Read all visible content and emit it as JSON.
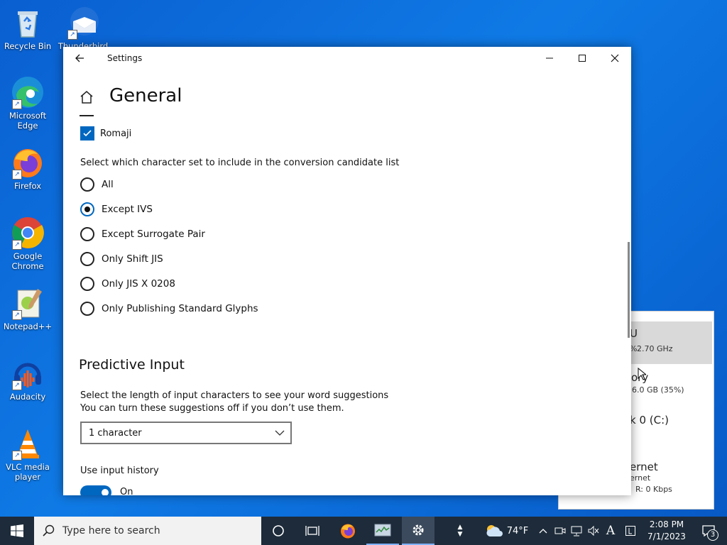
{
  "desktop": {
    "icons": [
      {
        "label": "Recycle Bin"
      },
      {
        "label": "Thunderbird"
      },
      {
        "label": "Microsoft Edge"
      },
      {
        "label": "Firefox"
      },
      {
        "label": "Google Chrome"
      },
      {
        "label": "Notepad++"
      },
      {
        "label": "Audacity"
      },
      {
        "label": "VLC media player"
      }
    ]
  },
  "task_manager": {
    "items": [
      {
        "title": "U",
        "detail": "2.70 GHz"
      },
      {
        "title": "ory",
        "detail": "6.0 GB (35%)"
      },
      {
        "title": "k 0 (C:)",
        "detail": ""
      },
      {
        "title": "ernet",
        "detail": "ernet",
        "detail2": "R: 0 Kbps"
      }
    ]
  },
  "window": {
    "title": "Settings",
    "page_title": "General",
    "romaji_label": "Romaji",
    "charset_prompt": "Select which character set to include in the conversion candidate list",
    "charset_options": [
      {
        "label": "All",
        "selected": false
      },
      {
        "label": "Except IVS",
        "selected": true
      },
      {
        "label": "Except Surrogate Pair",
        "selected": false
      },
      {
        "label": "Only Shift JIS",
        "selected": false
      },
      {
        "label": "Only JIS X 0208",
        "selected": false
      },
      {
        "label": "Only Publishing Standard Glyphs",
        "selected": false
      }
    ],
    "predictive_heading": "Predictive Input",
    "predictive_desc1": "Select the length of input characters to see your word suggestions",
    "predictive_desc2": "You can turn these suggestions off if you don’t use them.",
    "predictive_select": "1 character",
    "history_label": "Use input history",
    "history_toggle": "On"
  },
  "taskbar": {
    "search_placeholder": "Type here to search",
    "weather": "74°F",
    "time": "2:08 PM",
    "date": "7/1/2023",
    "notifications": "3",
    "ime": "A"
  },
  "colors": {
    "accent": "#0067c0",
    "taskbar": "#1d2b3a"
  }
}
